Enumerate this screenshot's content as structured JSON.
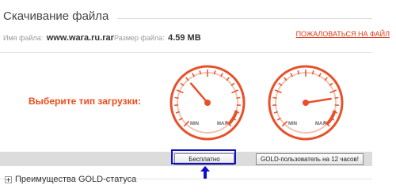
{
  "header": {
    "title": "Скачивание файла"
  },
  "file": {
    "name_label": "Имя файла:",
    "name_value": "www.wara.ru.rar",
    "size_label": "Размер файла:",
    "size_value": "4.59 MB",
    "report_link": "ПОЖАЛОВАТЬСЯ НА ФАЙЛ"
  },
  "download": {
    "prompt": "Выберите тип загрузки:",
    "gauge_min": "MIN",
    "gauge_max": "MAX",
    "free_needle_level": 0.35,
    "gold_needle_level": 0.8,
    "free_button": "Бесплатно",
    "gold_button": "GOLD-пользователь на 12 часов!"
  },
  "benefits": {
    "label": "Преимущества GOLD-статуса"
  },
  "colors": {
    "accent": "#ee4b1a",
    "gauge_stroke": "#e8502a",
    "highlight": "#1010c8",
    "bar": "#dcdcdc"
  },
  "icons": {
    "expand": "plus-icon",
    "pointer": "up-arrow-icon"
  }
}
